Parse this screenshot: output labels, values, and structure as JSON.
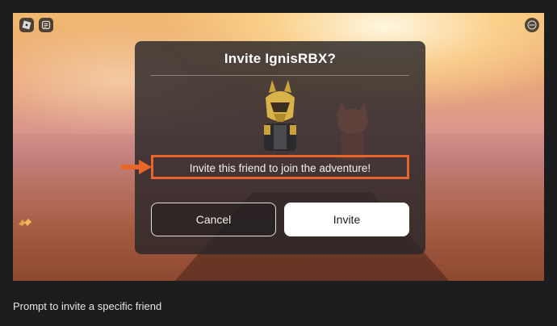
{
  "dialog": {
    "title": "Invite IgnisRBX?",
    "message": "Invite this friend to join the adventure!",
    "cancel_label": "Cancel",
    "invite_label": "Invite"
  },
  "caption": "Prompt to invite a specific friend",
  "colors": {
    "highlight": "#e8662a",
    "dialog_bg": "#2a282a",
    "invite_button_bg": "#ffffff",
    "page_bg": "#1b1c1e"
  },
  "icons": {
    "top_left": [
      "roblox-logo-icon",
      "chat-icon"
    ],
    "top_right": "more-options-icon",
    "annotation": "arrow-right-icon"
  }
}
